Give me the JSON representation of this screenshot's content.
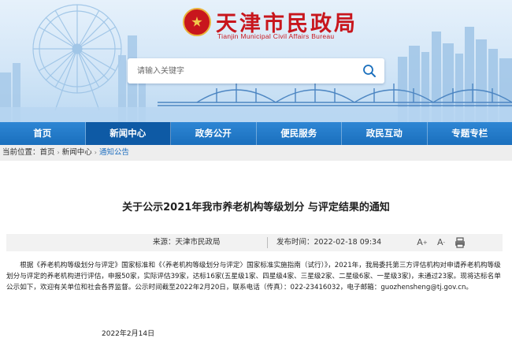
{
  "header": {
    "site_name_cn": "天津市民政局",
    "site_name_en": "Tianjin Municipal Civil Affairs Bureau"
  },
  "search": {
    "placeholder": "请输入关键字"
  },
  "nav": {
    "items": [
      {
        "label": "首页"
      },
      {
        "label": "新闻中心"
      },
      {
        "label": "政务公开"
      },
      {
        "label": "便民服务"
      },
      {
        "label": "政民互动"
      },
      {
        "label": "专题专栏"
      }
    ]
  },
  "breadcrumb": {
    "prefix": "当前位置：",
    "items": [
      "首页",
      "新闻中心",
      "通知公告"
    ]
  },
  "article": {
    "title": "关于公示2021年我市养老机构等级划分 与评定结果的通知",
    "source": "来源：天津市民政局",
    "published": "发布时间：2022-02-18 09:34",
    "body": "根据《养老机构等级划分与评定》国家标准和《〈养老机构等级划分与评定〉国家标准实施指南（试行）》，2021年，我局委托第三方评估机构对申请养老机构等级划分与评定的养老机构进行评估，申报50家，实际评估39家，达标16家(五星级1家、四星级4家、三星级2家、二星级6家、一星级3家)，未通过23家。现将达标名单公示如下，欢迎有关单位和社会各界监督。公示时间截至2022年2月20日，联系电话（传真）：022-23416032，电子邮箱：guozhensheng@tj.gov.cn。",
    "sign_date": "2022年2月14日"
  },
  "tools": {
    "font_larger": "A",
    "font_smaller": "A"
  },
  "colors": {
    "brand_red": "#c8161d",
    "nav_blue": "#1a6fbd",
    "nav_active": "#0e5aa5",
    "crumb_current": "#1f6fc0"
  }
}
